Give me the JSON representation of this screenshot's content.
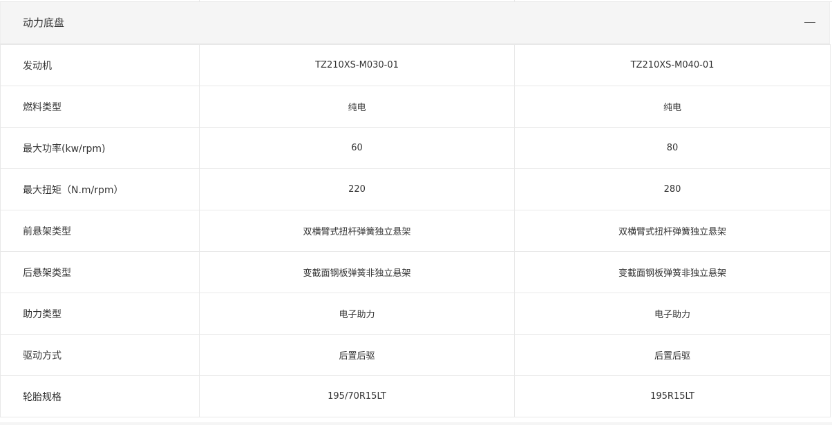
{
  "section": {
    "title": "动力底盘",
    "collapse_symbol": "—",
    "collapse_icon": "minus-icon"
  },
  "rows": [
    {
      "label": "发动机",
      "values": [
        "TZ210XS-M030-01",
        "TZ210XS-M040-01"
      ]
    },
    {
      "label": "燃料类型",
      "values": [
        "纯电",
        "纯电"
      ]
    },
    {
      "label": "最大功率(kw/rpm)",
      "values": [
        "60",
        "80"
      ]
    },
    {
      "label": "最大扭矩（N.m/rpm）",
      "values": [
        "220",
        "280"
      ]
    },
    {
      "label": "前悬架类型",
      "values": [
        "双横臂式扭杆弹簧独立悬架",
        "双横臂式扭杆弹簧独立悬架"
      ]
    },
    {
      "label": "后悬架类型",
      "values": [
        "变截面钢板弹簧非独立悬架",
        "变截面钢板弹簧非独立悬架"
      ]
    },
    {
      "label": "助力类型",
      "values": [
        "电子助力",
        "电子助力"
      ]
    },
    {
      "label": "驱动方式",
      "values": [
        "后置后驱",
        "后置后驱"
      ]
    },
    {
      "label": "轮胎规格",
      "values": [
        "195/70R15LT",
        "195R15LT"
      ]
    }
  ],
  "colors": {
    "header_bg": "#f5f5f5",
    "border": "#e8e8e8",
    "text": "#333333"
  }
}
